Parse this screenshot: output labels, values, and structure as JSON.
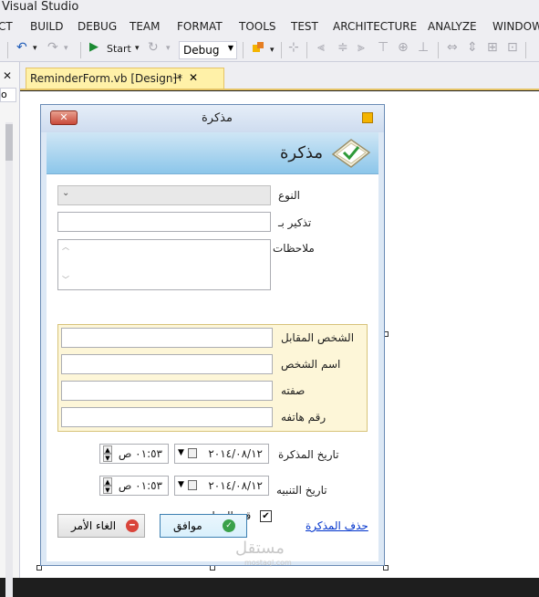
{
  "app": {
    "title": "Visual Studio"
  },
  "menu": [
    "CT",
    "BUILD",
    "DEBUG",
    "TEAM",
    "FORMAT",
    "TOOLS",
    "TEST",
    "ARCHITECTURE",
    "ANALYZE",
    "WINDOW"
  ],
  "toolbar": {
    "start_label": "Start",
    "configuration": "Debug"
  },
  "left_panel": {
    "input_value": "o"
  },
  "document_tab": {
    "label": "ReminderForm.vb [Design]*",
    "pin_icon": "pin-icon",
    "close_icon": "close-icon"
  },
  "form": {
    "title": "مذكرة",
    "close_glyph": "✕",
    "banner_title": "مذكرة",
    "fields": {
      "type_label": "النوع",
      "remind_by_label": "تذكير بـ",
      "notes_label": "ملاحظات"
    },
    "contact_group": {
      "contact_label": "الشخص المقابل",
      "name_label": "اسم الشخص",
      "title_label": "صفته",
      "phone_label": "رقم هاتفه"
    },
    "reminder_date": {
      "label": "تاريخ المذكرة",
      "date": "٢٠١٤/٠٨/١٢",
      "time": "٠١:٥٣ ص"
    },
    "alert_date": {
      "label": "تاريخ التنبيه",
      "date": "٢٠١٤/٠٨/١٢",
      "time": "٠١:٥٣ ص"
    },
    "in_progress": {
      "label": "قيد العمل",
      "checked": true
    },
    "buttons": {
      "cancel": "الغاء الأمر",
      "ok": "موافق"
    },
    "delete_link": "حذف المذكرة"
  },
  "watermark": {
    "text": "مستقل",
    "sub": "mostaql.com"
  },
  "colors": {
    "accent": "#0033cc",
    "tab_highlight": "#fff1a8",
    "banner": "#8cc6ea",
    "group_box": "#fdf6d8"
  }
}
